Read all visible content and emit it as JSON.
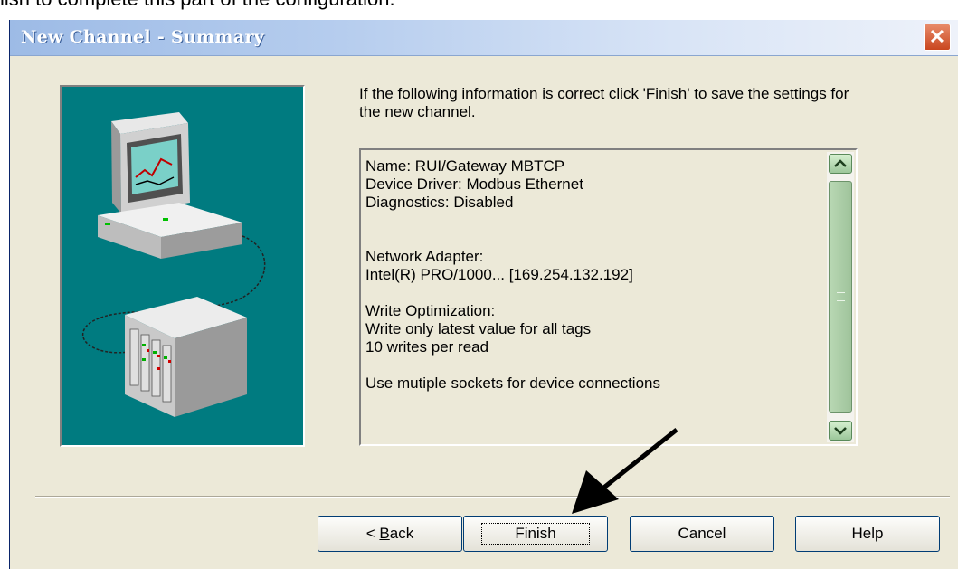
{
  "document": {
    "intro_text": "lish to complete this part of the configuration."
  },
  "window": {
    "title": "New Channel - Summary",
    "close_glyph": "✕"
  },
  "wizard": {
    "intro": "If the following information is correct click 'Finish' to save the settings for the new channel.",
    "summary_lines": [
      "Name: RUI/Gateway MBTCP",
      "Device Driver: Modbus Ethernet",
      "Diagnostics: Disabled",
      "",
      "",
      "Network Adapter:",
      "Intel(R) PRO/1000... [169.254.132.192]",
      "",
      "Write Optimization:",
      "Write only latest value for all tags",
      "10 writes per read",
      "",
      "Use mutiple sockets for device connections"
    ]
  },
  "buttons": {
    "back_prefix": "< ",
    "back_mnemonic": "B",
    "back_rest": "ack",
    "finish": "Finish",
    "cancel": "Cancel",
    "help": "Help"
  },
  "icons": {
    "scroll_up": "scroll-up-icon",
    "scroll_down": "scroll-down-icon",
    "annotation_arrow": "arrow-icon"
  },
  "colors": {
    "art_background": "#007b80",
    "dialog_face": "#ece9d8",
    "close_button": "#c9461f"
  }
}
